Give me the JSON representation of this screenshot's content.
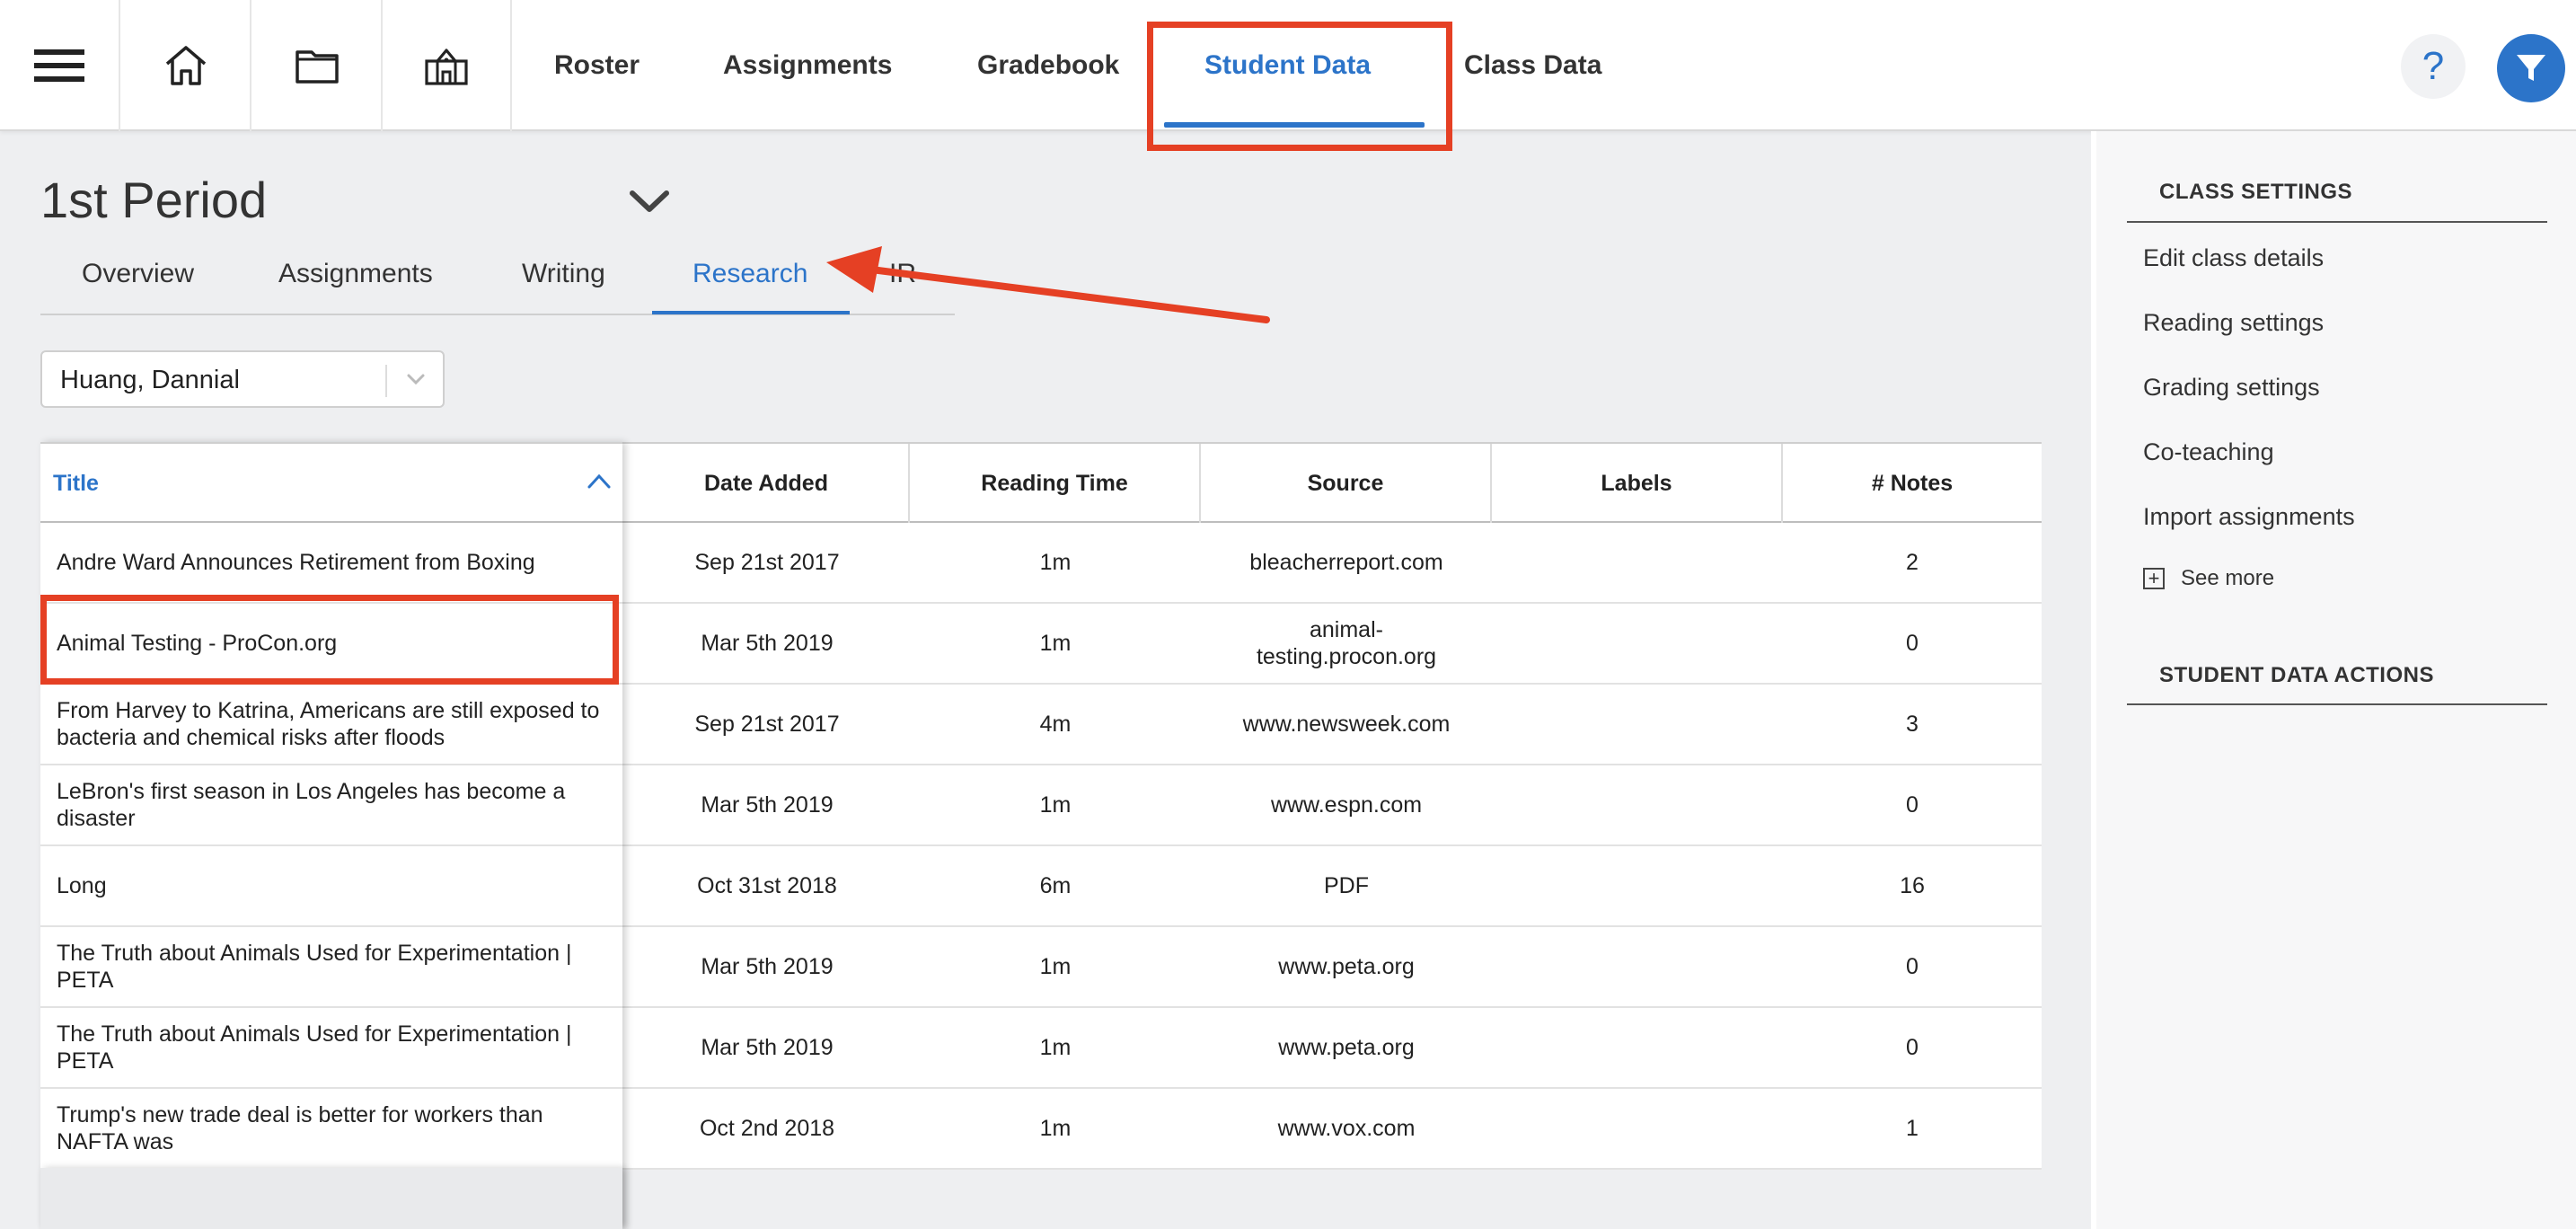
{
  "nav": {
    "links": [
      {
        "label": "Roster"
      },
      {
        "label": "Assignments"
      },
      {
        "label": "Gradebook"
      },
      {
        "label": "Student Data"
      },
      {
        "label": "Class Data"
      }
    ],
    "help_glyph": "?",
    "icons": [
      "menu-icon",
      "home-icon",
      "folder-icon",
      "school-icon",
      "filter-icon"
    ]
  },
  "page": {
    "class_title": "1st Period",
    "subtabs": [
      {
        "label": "Overview"
      },
      {
        "label": "Assignments"
      },
      {
        "label": "Writing"
      },
      {
        "label": "Research"
      },
      {
        "label": "IR"
      }
    ],
    "student_select": {
      "value": "Huang, Dannial"
    }
  },
  "table": {
    "columns": {
      "title": "Title",
      "date": "Date Added",
      "time": "Reading Time",
      "source": "Source",
      "labels": "Labels",
      "notes": "# Notes"
    },
    "rows": [
      {
        "title": "Andre Ward Announces Retirement from Boxing",
        "date": "Sep 21st 2017",
        "time": "1m",
        "source": "bleacherreport.com",
        "labels": "",
        "notes": "2"
      },
      {
        "title": "Animal Testing - ProCon.org",
        "date": "Mar 5th 2019",
        "time": "1m",
        "source": "animal-testing.procon.org",
        "labels": "",
        "notes": "0"
      },
      {
        "title": "From Harvey to Katrina, Americans are still exposed to bacteria and chemical risks after floods",
        "date": "Sep 21st 2017",
        "time": "4m",
        "source": "www.newsweek.com",
        "labels": "",
        "notes": "3"
      },
      {
        "title": "LeBron's first season in Los Angeles has become a disaster",
        "date": "Mar 5th 2019",
        "time": "1m",
        "source": "www.espn.com",
        "labels": "",
        "notes": "0"
      },
      {
        "title": "Long",
        "date": "Oct 31st 2018",
        "time": "6m",
        "source": "PDF",
        "labels": "",
        "notes": "16"
      },
      {
        "title": "The Truth about Animals Used for Experimentation | PETA",
        "date": "Mar 5th 2019",
        "time": "1m",
        "source": "www.peta.org",
        "labels": "",
        "notes": "0"
      },
      {
        "title": "The Truth about Animals Used for Experimentation | PETA",
        "date": "Mar 5th 2019",
        "time": "1m",
        "source": "www.peta.org",
        "labels": "",
        "notes": "0"
      },
      {
        "title": "Trump's new trade deal is better for workers than NAFTA was",
        "date": "Oct 2nd 2018",
        "time": "1m",
        "source": "www.vox.com",
        "labels": "",
        "notes": "1"
      }
    ]
  },
  "right_panel": {
    "class_settings_heading": "CLASS SETTINGS",
    "links": [
      {
        "label": "Edit class details"
      },
      {
        "label": "Reading settings"
      },
      {
        "label": "Grading settings"
      },
      {
        "label": "Co-teaching"
      },
      {
        "label": "Import assignments"
      }
    ],
    "see_more": "See more",
    "student_actions_heading": "STUDENT DATA ACTIONS"
  },
  "colors": {
    "accent": "#2c74c9",
    "annotation": "#e54024"
  }
}
